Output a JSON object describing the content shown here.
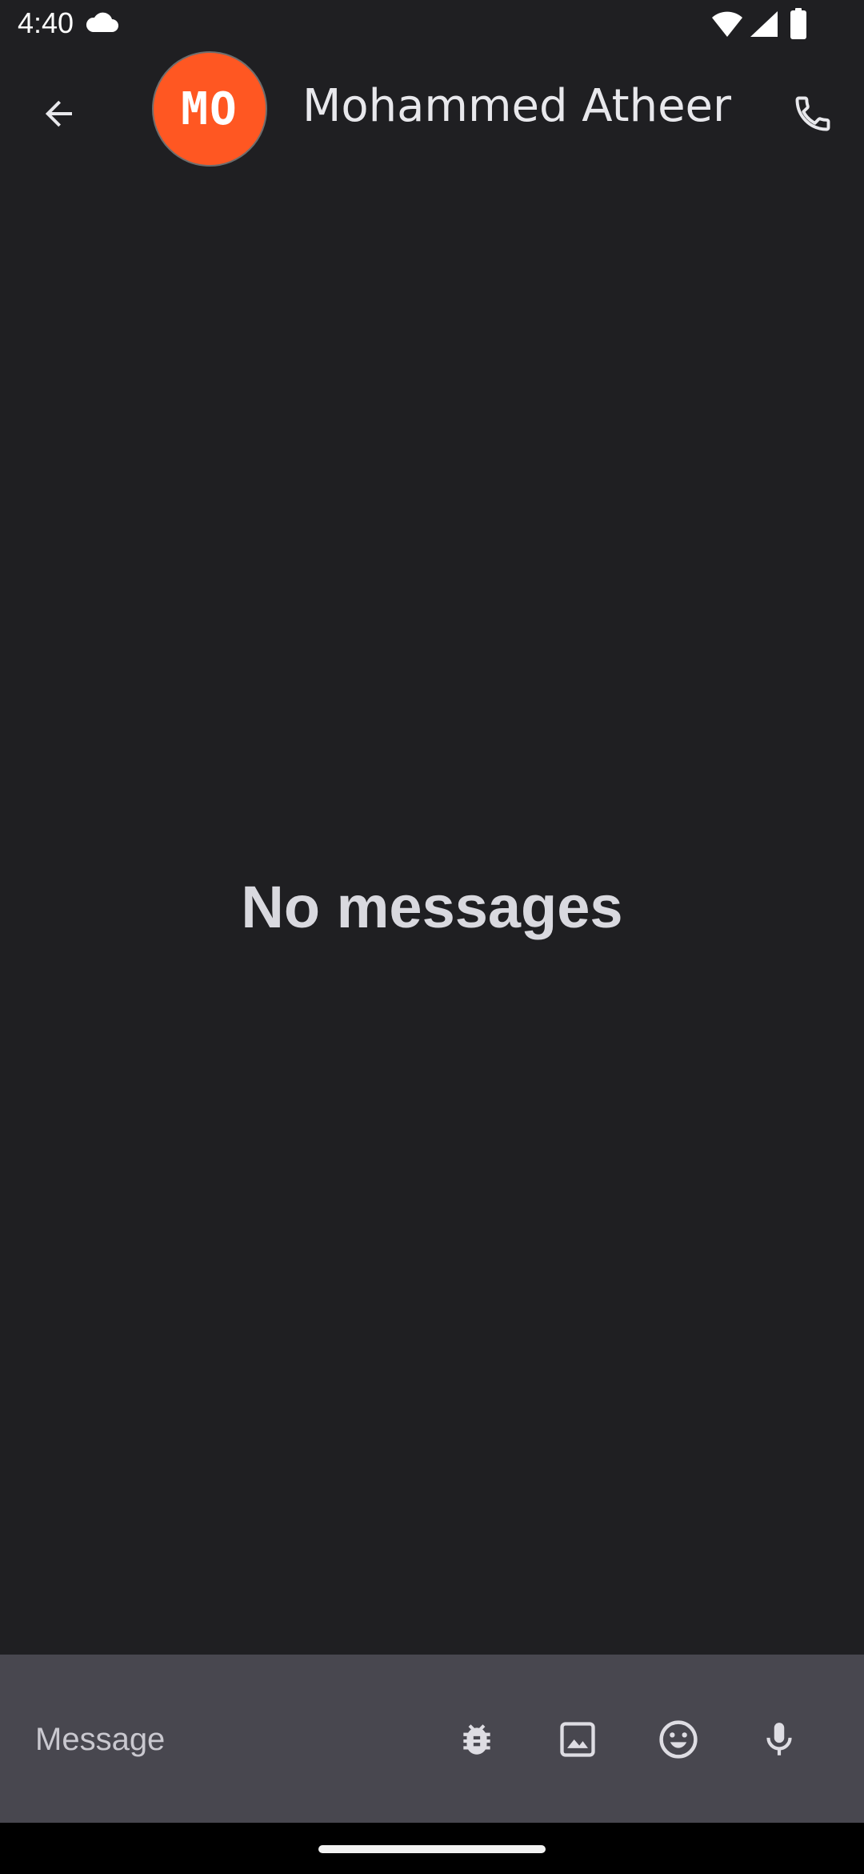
{
  "status_bar": {
    "time": "4:40",
    "icons": [
      "cloud-icon",
      "wifi-icon",
      "signal-icon",
      "battery-icon"
    ]
  },
  "header": {
    "avatar_initials": "MO",
    "avatar_color": "#ff5722",
    "contact_name": "Mohammed Atheer",
    "back_icon": "arrow-back-icon",
    "call_icon": "phone-icon"
  },
  "conversation": {
    "empty_text": "No messages"
  },
  "composer": {
    "placeholder": "Message",
    "buttons": [
      "bug-icon",
      "image-icon",
      "emoji-icon",
      "microphone-icon"
    ]
  },
  "colors": {
    "background": "#1f1f22",
    "composer_background": "#48474f",
    "accent": "#ff5722"
  }
}
